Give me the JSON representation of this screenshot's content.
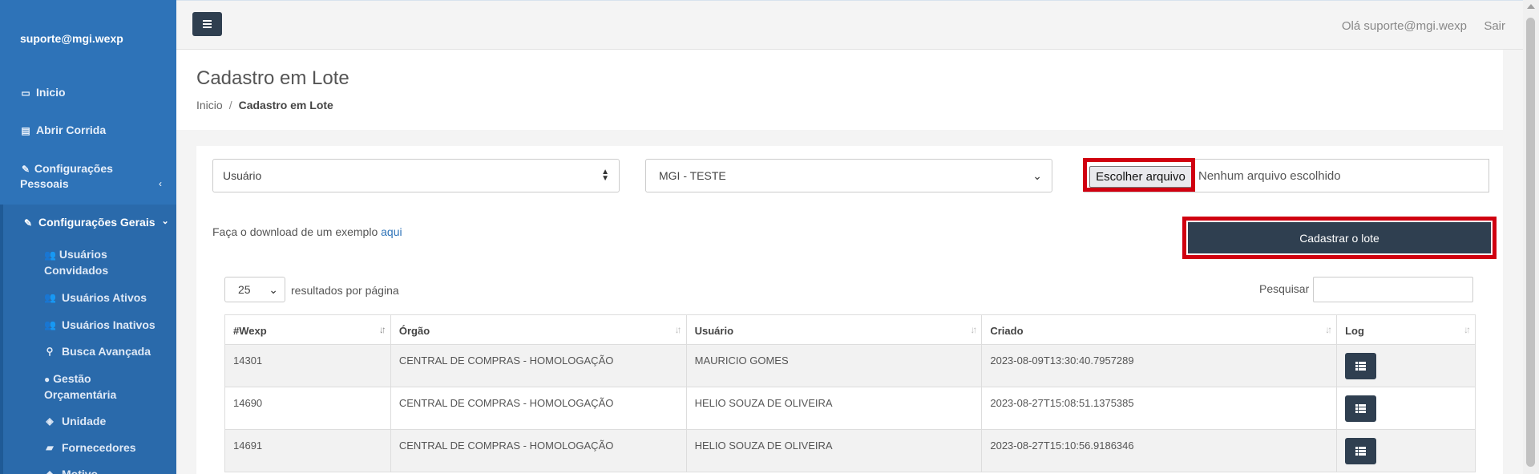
{
  "sidebar": {
    "user": "suporte@mgi.wexp",
    "items": [
      {
        "label": "Inicio",
        "icon": "laptop-icon"
      },
      {
        "label": "Abrir Corrida",
        "icon": "list-alt-icon"
      },
      {
        "label": "Configurações Pessoais",
        "icon": "edit-icon"
      },
      {
        "label": "Configurações Gerais",
        "icon": "edit-icon"
      }
    ],
    "subitems": [
      {
        "label": "Usuários Convidados",
        "icon": "users-icon"
      },
      {
        "label": "Usuários Ativos",
        "icon": "users-icon"
      },
      {
        "label": "Usuários Inativos",
        "icon": "users-icon"
      },
      {
        "label": "Busca Avançada",
        "icon": "search-icon"
      },
      {
        "label": "Gestão Orçamentária",
        "icon": "budget-icon"
      },
      {
        "label": "Unidade",
        "icon": "cubes-icon"
      },
      {
        "label": "Fornecedores",
        "icon": "car-icon"
      },
      {
        "label": "Motivo",
        "icon": "tag-icon"
      }
    ]
  },
  "topbar": {
    "greeting": "Olá suporte@mgi.wexp",
    "logout": "Sair"
  },
  "header": {
    "title": "Cadastro em Lote",
    "breadcrumb": {
      "home": "Inicio",
      "separator": "/",
      "current": "Cadastro em Lote"
    }
  },
  "form": {
    "type_select": "Usuário",
    "org_select": "MGI - TESTE",
    "file_button": "Escolher arquivo",
    "file_status": "Nenhum arquivo escolhido",
    "submit": "Cadastrar o lote",
    "download_text": "Faça o download de um exemplo",
    "download_link": "aqui"
  },
  "table_controls": {
    "page_length": "25",
    "page_length_label": "resultados por página",
    "search_label": "Pesquisar"
  },
  "table": {
    "columns": [
      "#Wexp",
      "Órgão",
      "Usuário",
      "Criado",
      "Log"
    ],
    "rows": [
      {
        "id": "14301",
        "orgao": "CENTRAL DE COMPRAS - HOMOLOGAÇÃO",
        "usuario": "MAURICIO GOMES",
        "criado": "2023-08-09T13:30:40.7957289"
      },
      {
        "id": "14690",
        "orgao": "CENTRAL DE COMPRAS - HOMOLOGAÇÃO",
        "usuario": "HELIO SOUZA DE OLIVEIRA",
        "criado": "2023-08-27T15:08:51.1375385"
      },
      {
        "id": "14691",
        "orgao": "CENTRAL DE COMPRAS - HOMOLOGAÇÃO",
        "usuario": "HELIO SOUZA DE OLIVEIRA",
        "criado": "2023-08-27T15:10:56.9186346"
      }
    ]
  },
  "colors": {
    "sidebar": "#2e73b8",
    "dark_button": "#2f3f50",
    "highlight": "#d00010"
  }
}
